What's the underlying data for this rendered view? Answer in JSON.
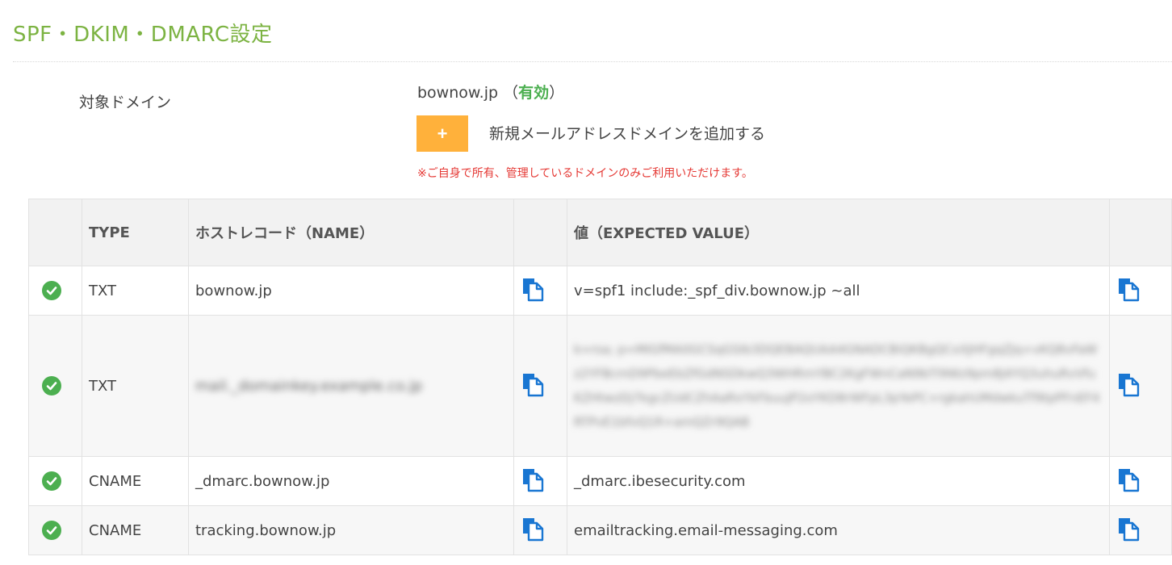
{
  "page": {
    "title": "SPF・DKIM・DMARC設定"
  },
  "domain_section": {
    "label": "対象ドメイン",
    "domain": "bownow.jp",
    "status_open": " （",
    "status": "有効",
    "status_close": "）",
    "add_button_label": "+",
    "add_label": "新規メールアドレスドメインを追加する",
    "notice": "※ご自身で所有、管理しているドメインのみご利用いただけます。"
  },
  "table": {
    "headers": {
      "status": "",
      "type": "TYPE",
      "host": "ホストレコード（NAME）",
      "host_copy": "",
      "value": "値（EXPECTED VALUE）",
      "value_copy": ""
    },
    "rows": [
      {
        "type": "TXT",
        "host": "bownow.jp",
        "value": "v=spf1 include:_spf_div.bownow.jp ~all",
        "verified": true
      },
      {
        "type": "TXT",
        "host": "mail._domainkey.example.co.jp",
        "value": "k=rsa; p=MIGfMA0GCSqGSIb3DQEBAQUAA4GNADCBiQKBgQCxXJHFgqZJq+vKQ8vFaWz2YFBcmD9PbeEbZfGdNSDkwQ3WHRmYBC2KgFWnCaN9bTl9Wz9pm8J4YQ3uhuRvVfuKZHtwzDj7kgcZUdCZhAaRxYkFbuuJP2oYKD8rWFpL3pYePC+rgkahUMdwkuTf9tpPFnEF4RTPvE1bfvQ1R+amQZr9QAB",
        "verified": true,
        "blurred": true
      },
      {
        "type": "CNAME",
        "host": "_dmarc.bownow.jp",
        "value": "_dmarc.ibesecurity.com",
        "verified": true
      },
      {
        "type": "CNAME",
        "host": "tracking.bownow.jp",
        "value": "emailtracking.email-messaging.com",
        "verified": true
      }
    ]
  },
  "icons": {
    "status": "check-circle-icon",
    "copy": "copy-icon"
  },
  "colors": {
    "title": "#7cb342",
    "status_ok": "#4caf50",
    "add_button": "#ffb13b",
    "notice": "#e53935",
    "copy_icon": "#1976d2"
  }
}
